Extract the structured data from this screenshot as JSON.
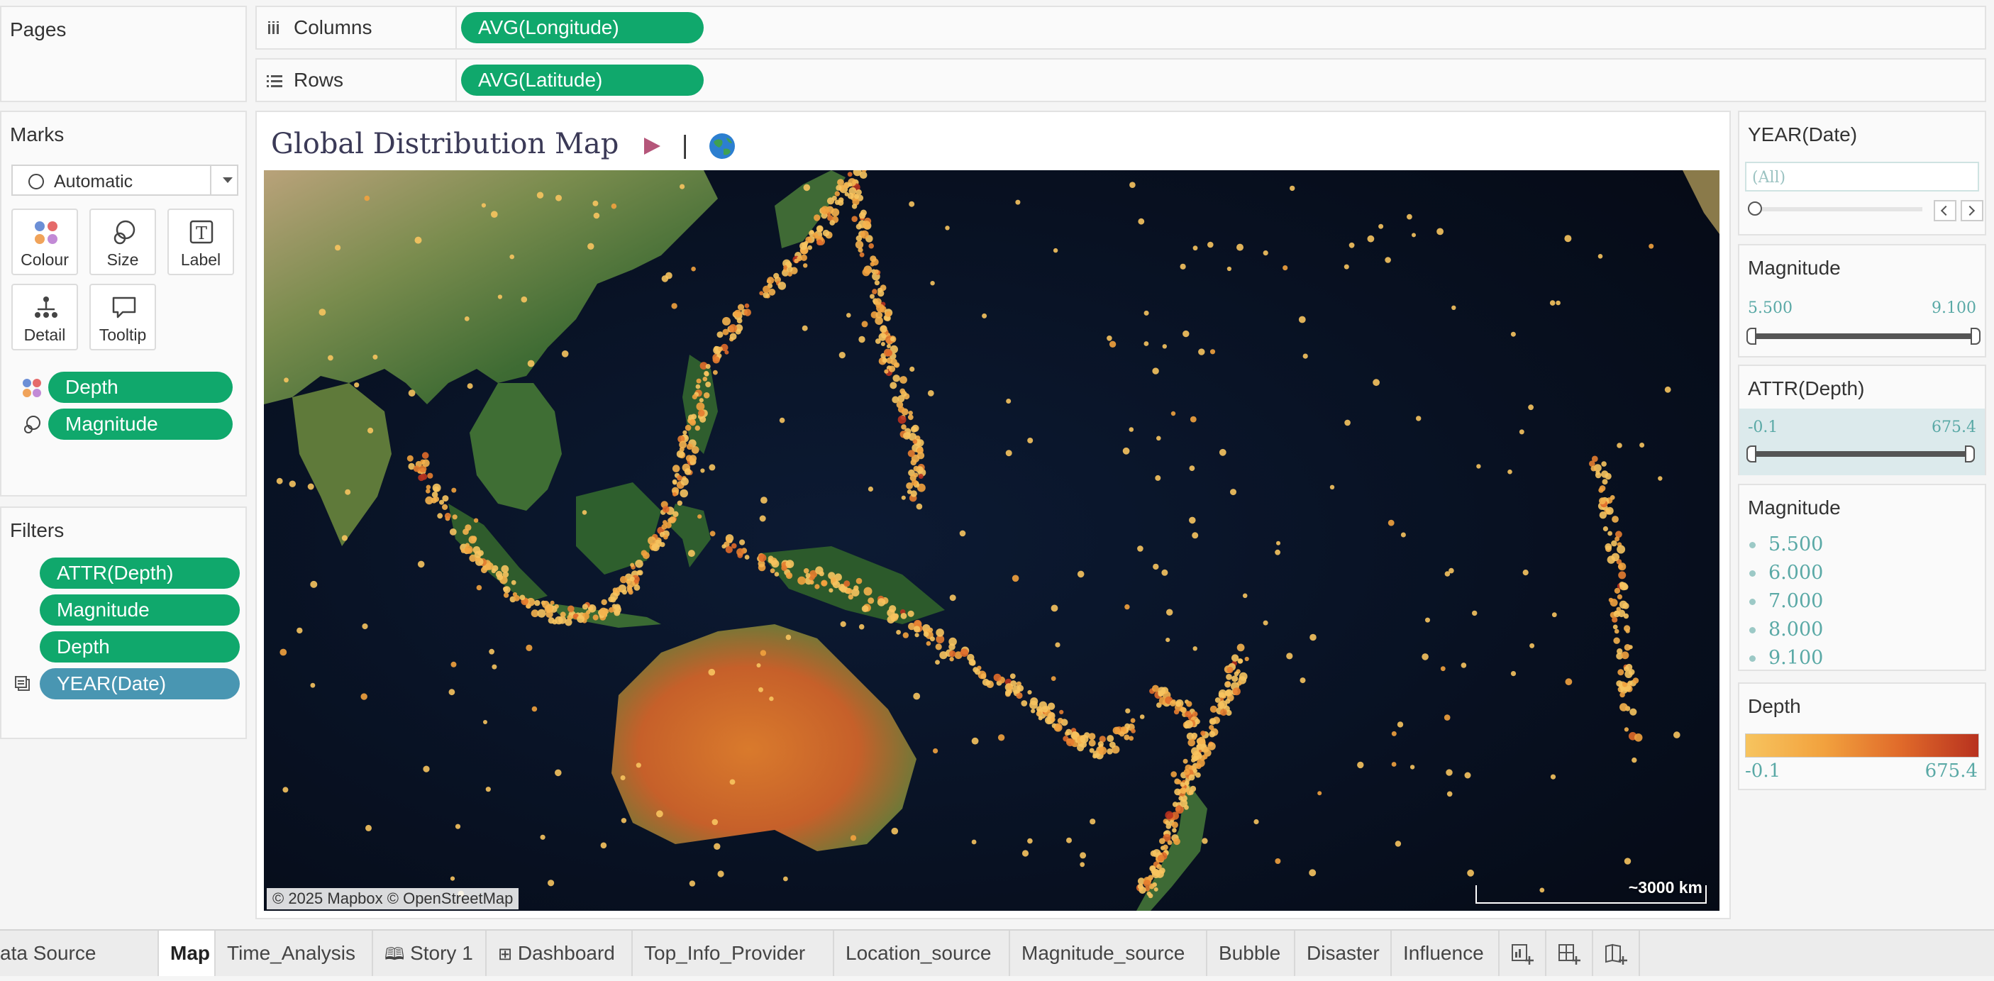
{
  "shelves": {
    "pages_title": "Pages",
    "columns_label": "Columns",
    "columns_pill": "AVG(Longitude)",
    "rows_label": "Rows",
    "rows_pill": "AVG(Latitude)"
  },
  "marks": {
    "title": "Marks",
    "mark_type": "Automatic",
    "buttons": [
      "Colour",
      "Size",
      "Label",
      "Detail",
      "Tooltip"
    ],
    "pills": [
      "Depth",
      "Magnitude"
    ]
  },
  "filters": {
    "title": "Filters",
    "pills": [
      "ATTR(Depth)",
      "Magnitude",
      "Depth",
      "YEAR(Date)"
    ]
  },
  "view": {
    "title": "Global Distribution Map",
    "separator": "|",
    "attribution": "© 2025 Mapbox © OpenStreetMap",
    "scale_label": "~3000 km"
  },
  "right_panel": {
    "year_filter": {
      "title": "YEAR(Date)",
      "value": "(All)"
    },
    "magnitude_filter": {
      "title": "Magnitude",
      "min": "5.500",
      "max": "9.100"
    },
    "depth_filter": {
      "title": "ATTR(Depth)",
      "min": "-0.1",
      "max": "675.4"
    },
    "size_legend": {
      "title": "Magnitude",
      "items": [
        "5.500",
        "6.000",
        "7.000",
        "8.000",
        "9.100"
      ]
    },
    "color_legend": {
      "title": "Depth",
      "min": "-0.1",
      "max": "675.4",
      "colors": [
        "#f7c45f",
        "#f2a23e",
        "#e06a2a",
        "#b8321f"
      ]
    }
  },
  "tabs": {
    "items": [
      "ata Source",
      "Map",
      "Time_Analysis",
      "Story 1",
      "Dashboard",
      "Top_Info_Provider",
      "Location_source",
      "Magnitude_source",
      "Bubble",
      "Disaster",
      "Influence"
    ],
    "active": "Map"
  },
  "colors": {
    "pill_green": "#10a86c",
    "pill_blue": "#4996b2",
    "title_color": "#3b3a57",
    "play_icon": "#b5567a"
  }
}
